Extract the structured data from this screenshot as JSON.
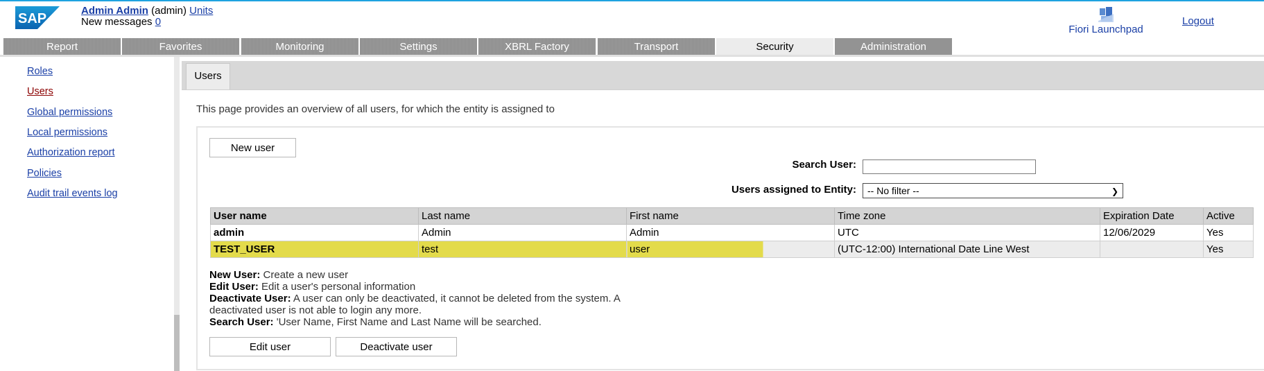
{
  "header": {
    "user_name": "Admin Admin",
    "user_id": "(admin)",
    "units_link": "Units",
    "messages_label": "New messages",
    "messages_count": "0",
    "fiori_label": "Fiori Launchpad",
    "logout_label": "Logout"
  },
  "nav": {
    "tabs": [
      "Report",
      "Favorites",
      "Monitoring",
      "Settings",
      "XBRL Factory",
      "Transport",
      "Security",
      "Administration"
    ],
    "active": "Security"
  },
  "sidebar": {
    "items": [
      {
        "label": "Roles"
      },
      {
        "label": "Users"
      },
      {
        "label": "Global permissions"
      },
      {
        "label": "Local permissions"
      },
      {
        "label": "Authorization report"
      },
      {
        "label": "Policies"
      },
      {
        "label": "Audit trail events log"
      }
    ],
    "current": "Users"
  },
  "main": {
    "tab_label": "Users",
    "intro": "This page provides an overview of all users, for which the entity is assigned to",
    "new_user_button": "New user",
    "search_label": "Search User:",
    "search_value": "",
    "entity_label": "Users assigned to Entity:",
    "entity_value": "-- No filter --",
    "table": {
      "headers": [
        "User name",
        "Last name",
        "First name",
        "Time zone",
        "Expiration Date",
        "Active"
      ],
      "rows": [
        {
          "user": "admin",
          "last": "Admin",
          "first": "Admin",
          "tz": "UTC",
          "exp": "12/06/2029",
          "active": "Yes"
        },
        {
          "user": "TEST_USER",
          "last": "test",
          "first": "user",
          "tz": "(UTC-12:00) International Date Line West",
          "exp": "",
          "active": "Yes"
        }
      ]
    },
    "help": [
      {
        "term": "New User:",
        "text": " Create a new user"
      },
      {
        "term": "Edit User:",
        "text": " Edit a user's personal information"
      },
      {
        "term": "Deactivate User:",
        "text": " A user can only be deactivated, it cannot be deleted from the system. A deactivated user is not able to login any more."
      },
      {
        "term": "Search User:",
        "text": " 'User Name, First Name and Last Name will be searched."
      }
    ],
    "edit_user_button": "Edit user",
    "deactivate_user_button": "Deactivate user"
  },
  "colors": {
    "accent_line": "#1fa3e0",
    "link": "#1a3fa6",
    "highlight": "#e3db4b"
  }
}
